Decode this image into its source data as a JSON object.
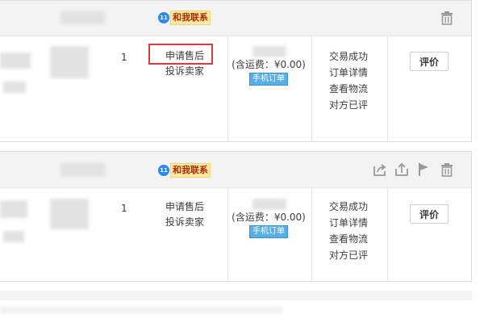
{
  "orders": [
    {
      "contact_label": "和我联系",
      "ww_label": "11",
      "quantity": "1",
      "after_sale": [
        "申请售后",
        "投诉卖家"
      ],
      "shipping": "(含运费：¥0.00)",
      "source_badge": "手机订单",
      "status_links": [
        "交易成功",
        "订单详情",
        "查看物流",
        "对方已评"
      ],
      "rate_button": "评价"
    },
    {
      "contact_label": "和我联系",
      "ww_label": "11",
      "quantity": "1",
      "after_sale": [
        "申请售后",
        "投诉卖家"
      ],
      "shipping": "(含运费：¥0.00)",
      "source_badge": "手机订单",
      "status_links": [
        "交易成功",
        "订单详情",
        "查看物流",
        "对方已评"
      ],
      "rate_button": "评价"
    }
  ],
  "colors": {
    "highlight": "#e0393c",
    "contact_bg": "#fde9a2",
    "badge": "#5aaee6",
    "wangwang": "#2e8ae6"
  }
}
